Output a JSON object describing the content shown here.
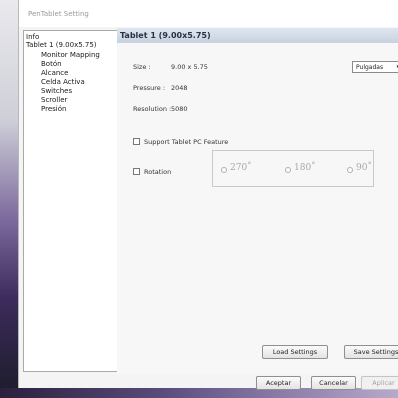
{
  "window": {
    "title": "PenTablet Setting"
  },
  "tree": {
    "items": [
      {
        "label": "Info",
        "level": 0
      },
      {
        "label": "Tablet  1 (9.00x5.75)",
        "level": 0
      },
      {
        "label": "Monitor Mapping",
        "level": 1
      },
      {
        "label": "Botón",
        "level": 1
      },
      {
        "label": "Alcance",
        "level": 1
      },
      {
        "label": "Celda Activa",
        "level": 1
      },
      {
        "label": "Switches",
        "level": 1
      },
      {
        "label": "Scroller",
        "level": 1
      },
      {
        "label": "Presión",
        "level": 1
      }
    ]
  },
  "panel": {
    "header": "Tablet  1 (9.00x5.75)",
    "size_label": "Size :",
    "size_value": "9.00 x 5.75",
    "pressure_label": "Pressure :",
    "pressure_value": "2048",
    "resolution_label": "Resolution :",
    "resolution_value": "5080",
    "units_select": {
      "selected": "Pulgadas"
    },
    "support_tablet_pc": {
      "label": "Support Tablet PC Feature",
      "checked": false
    },
    "rotation": {
      "label": "Rotation",
      "checked": false,
      "options": [
        "270˚",
        "180˚",
        "90˚"
      ]
    },
    "load_settings": "Load Settings",
    "save_settings": "Save Settings"
  },
  "footer": {
    "accept": "Aceptar",
    "cancel": "Cancelar",
    "apply": "Aplicar"
  },
  "icons": {
    "select_arrow": "▾"
  }
}
